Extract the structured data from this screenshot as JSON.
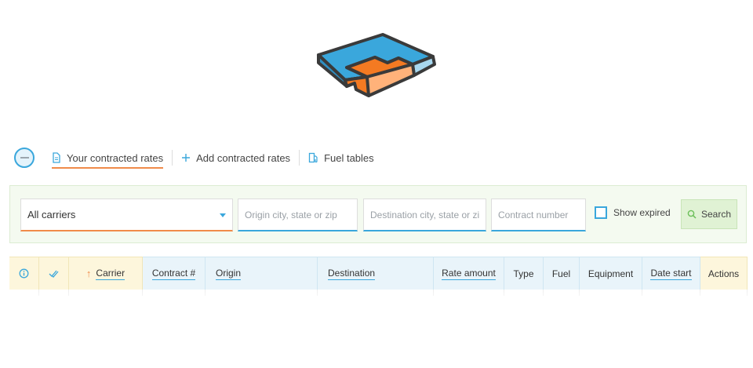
{
  "brand": {
    "colors": {
      "blue": "#3aa7dc",
      "light_blue": "#a8d8ef",
      "orange": "#f47a22",
      "light_orange": "#ffb27a",
      "outline": "#3a3a3a"
    }
  },
  "nav": {
    "collapse_icon": "minus-circle-icon",
    "tabs": [
      {
        "label": "Your contracted rates",
        "icon": "document-icon",
        "active": true
      },
      {
        "label": "Add contracted rates",
        "icon": "plus-icon"
      },
      {
        "label": "Fuel tables",
        "icon": "fuel-pump-icon"
      }
    ]
  },
  "filters": {
    "carrier_select": {
      "value": "All carriers",
      "icon": "caret-down-icon"
    },
    "origin": {
      "placeholder": "Origin city, state or zip",
      "value": ""
    },
    "destination": {
      "placeholder": "Destination city, state or zip",
      "value": ""
    },
    "contract_number": {
      "placeholder": "Contract number",
      "value": ""
    },
    "show_expired": {
      "label": "Show expired",
      "checked": false
    },
    "search": {
      "label": "Search",
      "icon": "search-icon"
    }
  },
  "table": {
    "columns": [
      {
        "key": "info",
        "label": "",
        "icon": "info-icon"
      },
      {
        "key": "select",
        "label": "",
        "icon": "double-check-icon"
      },
      {
        "key": "carrier",
        "label": "Carrier",
        "sortable": true,
        "sort": "asc",
        "icon": "arrow-up-icon"
      },
      {
        "key": "contract",
        "label": "Contract #",
        "sortable": true
      },
      {
        "key": "origin",
        "label": "Origin",
        "sortable": true
      },
      {
        "key": "destination",
        "label": "Destination",
        "sortable": true
      },
      {
        "key": "rate",
        "label": "Rate amount",
        "sortable": true
      },
      {
        "key": "type",
        "label": "Type"
      },
      {
        "key": "fuel",
        "label": "Fuel"
      },
      {
        "key": "equipment",
        "label": "Equipment"
      },
      {
        "key": "date_start",
        "label": "Date start",
        "sortable": true
      },
      {
        "key": "actions",
        "label": "Actions"
      }
    ]
  }
}
